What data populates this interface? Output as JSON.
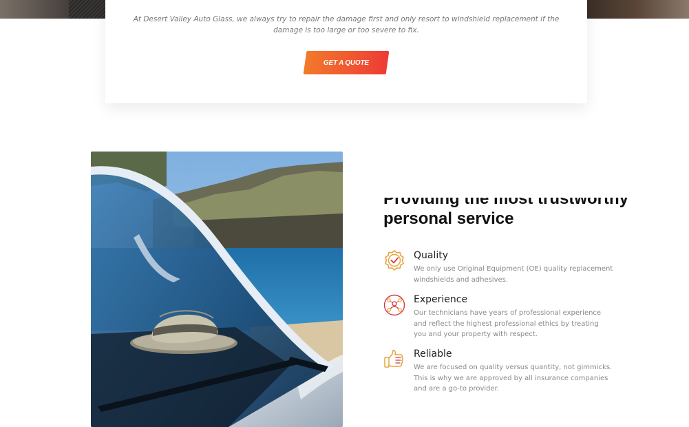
{
  "quote": {
    "text": "At Desert Valley Auto Glass, we always try to repair the damage first and only resort to windshield replacement if the damage is too large or too severe to fix.",
    "button_label": "GET A QUOTE"
  },
  "colors": {
    "accent_orange": "#f27a2a",
    "accent_red": "#ee3b35",
    "icon_gold": "#e8a33a",
    "icon_red": "#d9373c"
  },
  "features_section": {
    "heading": "Providing the most trustworthy personal service",
    "items": [
      {
        "icon": "quality-badge-icon",
        "title": "Quality",
        "description": "We only use Original Equipment (OE) quality replacement windshields and adhesives."
      },
      {
        "icon": "experience-network-icon",
        "title": "Experience",
        "description": "Our technicians have years of professional experience and reflect the highest professional ethics by treating you and your property with respect."
      },
      {
        "icon": "thumbs-up-icon",
        "title": "Reliable",
        "description": "We are focused on quality versus quantity, not gimmicks. This is why we are approved by all insurance companies and are a go-to provider."
      }
    ]
  }
}
